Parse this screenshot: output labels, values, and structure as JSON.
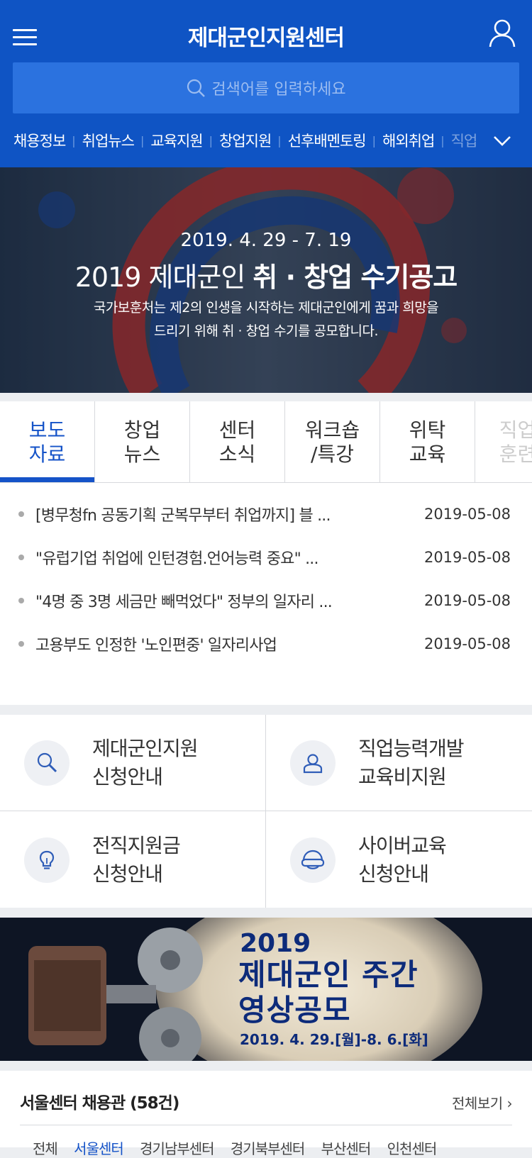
{
  "header": {
    "title": "제대군인지원센터",
    "search_placeholder": "검색어를 입력하세요",
    "categories": [
      "채용정보",
      "취업뉴스",
      "교육지원",
      "창업지원",
      "선후배멘토링",
      "해외취업",
      "직업"
    ]
  },
  "banner": {
    "dates": "2019. 4. 29 - 7. 19",
    "headline_prefix": "2019 제대군인 ",
    "headline_bold": "취 · 창업 수기공고",
    "desc_line1": "국가보훈처는 제2의 인생을 시작하는 제대군인에게 꿈과 희망을",
    "desc_line2": "드리기 위해 취 · 창업 수기를 공모합니다."
  },
  "news": {
    "tabs": [
      {
        "label": "보도\n자료"
      },
      {
        "label": "창업\n뉴스"
      },
      {
        "label": "센터\n소식"
      },
      {
        "label": "워크숍\n/특강"
      },
      {
        "label": "위탁\n교육"
      },
      {
        "label": "직업\n훈련"
      }
    ],
    "items": [
      {
        "title": "[병무청fn 공동기획 군복무부터 취업까지] 블 ...",
        "date": "2019-05-08"
      },
      {
        "title": "\"유럽기업 취업에 인턴경험.언어능력 중요\" ...",
        "date": "2019-05-08"
      },
      {
        "title": "\"4명 중 3명 세금만 빼먹었다\" 정부의 일자리 ...",
        "date": "2019-05-08"
      },
      {
        "title": "고용부도 인정한 '노인편중' 일자리사업",
        "date": "2019-05-08"
      }
    ]
  },
  "services": [
    {
      "label": "제대군인지원\n신청안내",
      "icon": "magnifier-icon"
    },
    {
      "label": "직업능력개발\n교육비지원",
      "icon": "person-icon"
    },
    {
      "label": "전직지원금\n신청안내",
      "icon": "lightbulb-icon"
    },
    {
      "label": "사이버교육\n신청안내",
      "icon": "headset-icon"
    }
  ],
  "video_banner": {
    "year": "2019",
    "title": "제대군인 주간\n영상공모",
    "date": "2019. 4. 29.[월]-8. 6.[화]"
  },
  "recruit": {
    "title": "서울센터 채용관 (58건)",
    "more": "전체보기 ›",
    "subtabs": [
      "전체",
      "서울센터",
      "경기남부센터",
      "경기북부센터",
      "부산센터",
      "인천센터"
    ]
  },
  "colors": {
    "brand": "#0f54c4",
    "accent": "#1553c8"
  }
}
